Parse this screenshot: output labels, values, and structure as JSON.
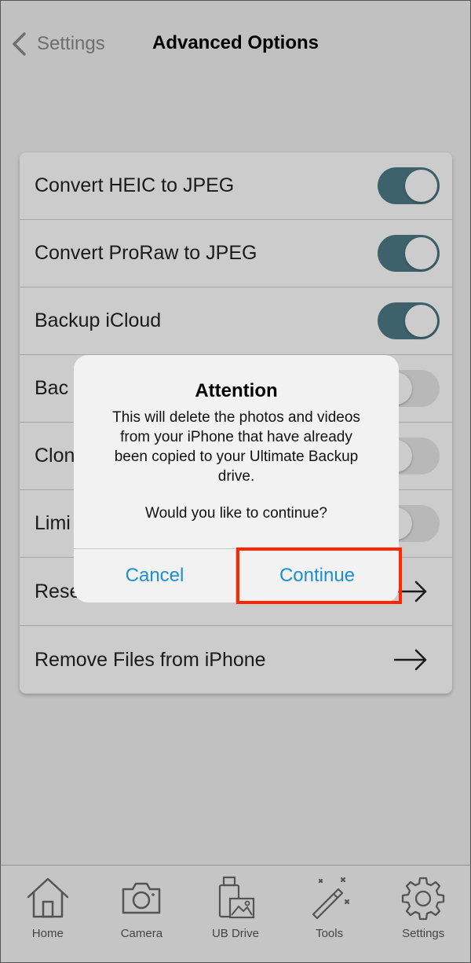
{
  "header": {
    "back_label": "Settings",
    "title": "Advanced Options"
  },
  "settings": {
    "rows": [
      {
        "label": "Convert HEIC to JPEG",
        "control": "toggle",
        "on": true
      },
      {
        "label": "Convert ProRaw to JPEG",
        "control": "toggle",
        "on": true
      },
      {
        "label": "Backup iCloud",
        "control": "toggle",
        "on": true
      },
      {
        "label": "Bac",
        "control": "toggle",
        "on": false
      },
      {
        "label": "Clon",
        "control": "toggle",
        "on": false
      },
      {
        "label": "Limi",
        "control": "toggle",
        "on": false
      },
      {
        "label": "Rese",
        "control": "arrow"
      },
      {
        "label": "Remove Files from iPhone",
        "control": "arrow"
      }
    ]
  },
  "alert": {
    "title": "Attention",
    "message": "This will delete the photos and videos\nfrom your iPhone that have already\nbeen copied to your Ultimate Backup\ndrive.",
    "question": "Would you like to continue?",
    "cancel_label": "Cancel",
    "continue_label": "Continue"
  },
  "tabbar": {
    "tabs": [
      {
        "label": "Home",
        "icon": "home-icon"
      },
      {
        "label": "Camera",
        "icon": "camera-icon"
      },
      {
        "label": "UB Drive",
        "icon": "ub-drive-icon"
      },
      {
        "label": "Tools",
        "icon": "magic-wand-icon"
      },
      {
        "label": "Settings",
        "icon": "gear-icon"
      }
    ]
  },
  "colors": {
    "toggle_on": "#4e7b88",
    "link_blue": "#1a8fd1",
    "highlight_red": "#ff2600"
  }
}
